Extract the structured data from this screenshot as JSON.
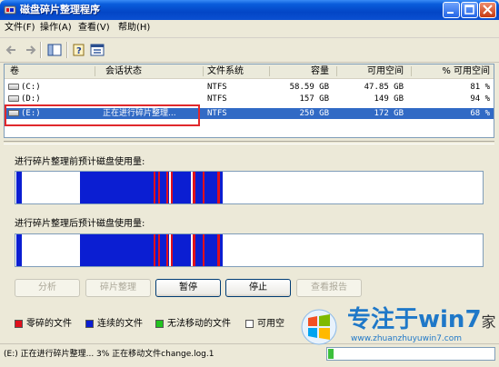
{
  "window": {
    "title": "磁盘碎片整理程序"
  },
  "menu": [
    "文件(F)",
    "操作(A)",
    "查看(V)",
    "帮助(H)"
  ],
  "columns": [
    "卷",
    "会话状态",
    "文件系统",
    "容量",
    "可用空间",
    "% 可用空间"
  ],
  "volumes": [
    {
      "name": "(C:)",
      "status": "",
      "fs": "NTFS",
      "capacity": "58.59 GB",
      "free": "47.85 GB",
      "pct_free": "81 %"
    },
    {
      "name": "(D:)",
      "status": "",
      "fs": "NTFS",
      "capacity": "157 GB",
      "free": "149 GB",
      "pct_free": "94 %"
    },
    {
      "name": "(E:)",
      "status": "正在进行碎片整理...",
      "fs": "NTFS",
      "capacity": "250 GB",
      "free": "172 GB",
      "pct_free": "68 %"
    }
  ],
  "analysis": {
    "before_label": "进行碎片整理前预计磁盘使用量:",
    "after_label": "进行碎片整理后预计磁盘使用量:"
  },
  "buttons": {
    "analyze": "分析",
    "defragment": "碎片整理",
    "pause": "暂停",
    "stop": "停止",
    "view_report": "查看报告"
  },
  "legend": [
    {
      "label": "零碎的文件",
      "color": "#e0101c"
    },
    {
      "label": "连续的文件",
      "color": "#0b1ed2"
    },
    {
      "label": "无法移动的文件",
      "color": "#22c31f"
    },
    {
      "label": "可用空",
      "color": "#ffffff"
    }
  ],
  "status": {
    "text": "(E:) 正在进行碎片整理...  3%  正在移动文件change.log.1",
    "progress": 0.03
  },
  "watermark": {
    "title": "专注于win7",
    "suffix": "家",
    "url": "www.zhuanzhuyuwin7.com"
  },
  "colors": {
    "fragmented": "#e0101c",
    "contiguous": "#0b1ed2",
    "unmovable": "#22c31f",
    "free": "#ffffff",
    "selection": "#316ac5"
  }
}
